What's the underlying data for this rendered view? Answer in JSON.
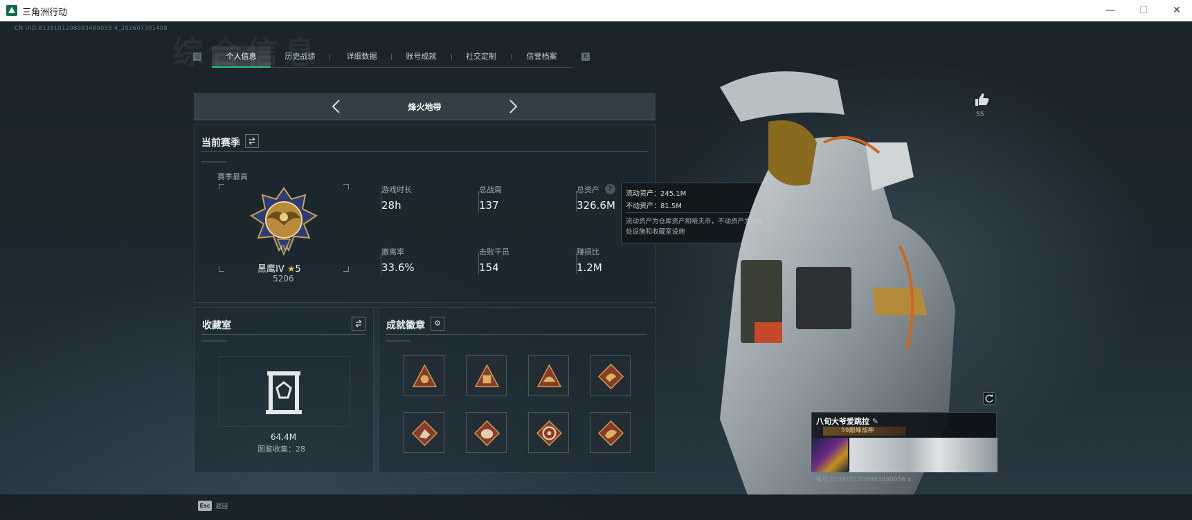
{
  "window": {
    "title": "三角洲行动",
    "minimize": "—",
    "maximize": "☐",
    "close": "✕"
  },
  "uid_header": "CN UID:8139101208083480059 4_202607301408",
  "watermark": "综合信息",
  "tabs": {
    "key_left": "Q",
    "key_right": "E",
    "items": [
      {
        "label": "个人信息",
        "active": true
      },
      {
        "label": "历史战绩",
        "active": false
      },
      {
        "label": "详细数据",
        "active": false
      },
      {
        "label": "账号成就",
        "active": false
      },
      {
        "label": "社交定制",
        "active": false
      },
      {
        "label": "信誉档案",
        "active": false
      }
    ]
  },
  "mode": {
    "title": "烽火地带",
    "prev_icon": "chevron-left-icon",
    "next_icon": "chevron-right-icon"
  },
  "season": {
    "title": "当前赛季",
    "swap_icon": "swap-icon",
    "best_label": "赛季最高",
    "rank_name": "黑鹰IV",
    "rank_stars": "5",
    "rank_score": "5206",
    "stats": [
      {
        "label": "游戏时长",
        "value": "28h"
      },
      {
        "label": "总战局",
        "value": "137"
      },
      {
        "label": "总资产",
        "value": "326.6M"
      },
      {
        "label": "撤离率",
        "value": "33.6%"
      },
      {
        "label": "击败干员",
        "value": "154"
      },
      {
        "label": "赚损比",
        "value": "1.2M"
      }
    ],
    "help_icon": "?"
  },
  "tooltip": {
    "line1": "流动资产：245.1M",
    "line2": "不动资产：81.5M",
    "desc": "流动资产为仓库资产和哈夫币，不动资产为特勤处设施和收藏室设施"
  },
  "collection": {
    "title": "收藏室",
    "value": "64.4M",
    "collected_label": "图鉴收集：",
    "collected_value": "28"
  },
  "badges": {
    "title": "成就徽章",
    "items": [
      "trophy-badge",
      "bag-badge",
      "helmet-badge",
      "dragon-badge",
      "runner-badge",
      "beast-badge",
      "wheel-badge",
      "dragon-gold-badge"
    ]
  },
  "player": {
    "likes": "55",
    "name": "八旬大爷爱跳拉",
    "title_badge": "59巅峰战神",
    "uid": "编号:8139101208083480059 4"
  },
  "footer": {
    "esc_key": "Esc",
    "esc_label": "返回"
  },
  "colors": {
    "accent": "#27c27a",
    "gold": "#c9a14a",
    "badge_red": "#8a3a2a"
  }
}
